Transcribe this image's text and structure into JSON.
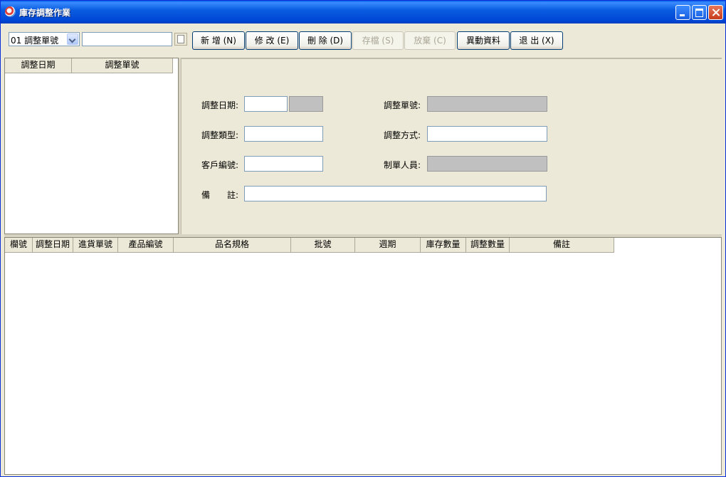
{
  "window": {
    "title": "庫存調整作業"
  },
  "toolbar": {
    "selector": "01 調整單號",
    "search_value": "",
    "buttons": {
      "new": "新 增 (N)",
      "edit": "修 改 (E)",
      "delete": "刪 除 (D)",
      "save": "存檔 (S)",
      "discard": "放棄 (C)",
      "change": "異動資料",
      "exit": "退 出 (X)"
    }
  },
  "left_list": {
    "columns": [
      "調整日期",
      "調整單號"
    ]
  },
  "form": {
    "adjust_date_label": "調整日期:",
    "adjust_no_label": "調整單號:",
    "adjust_type_label": "調整類型:",
    "adjust_method_label": "調整方式:",
    "customer_no_label": "客戶編號:",
    "creator_label": "制單人員:",
    "remark_label": "備　　註:"
  },
  "detail_grid": {
    "columns": [
      "欄號",
      "調整日期",
      "進貨單號",
      "產品編號",
      "品名規格",
      "批號",
      "週期",
      "庫存數量",
      "調整數量",
      "備註"
    ]
  }
}
